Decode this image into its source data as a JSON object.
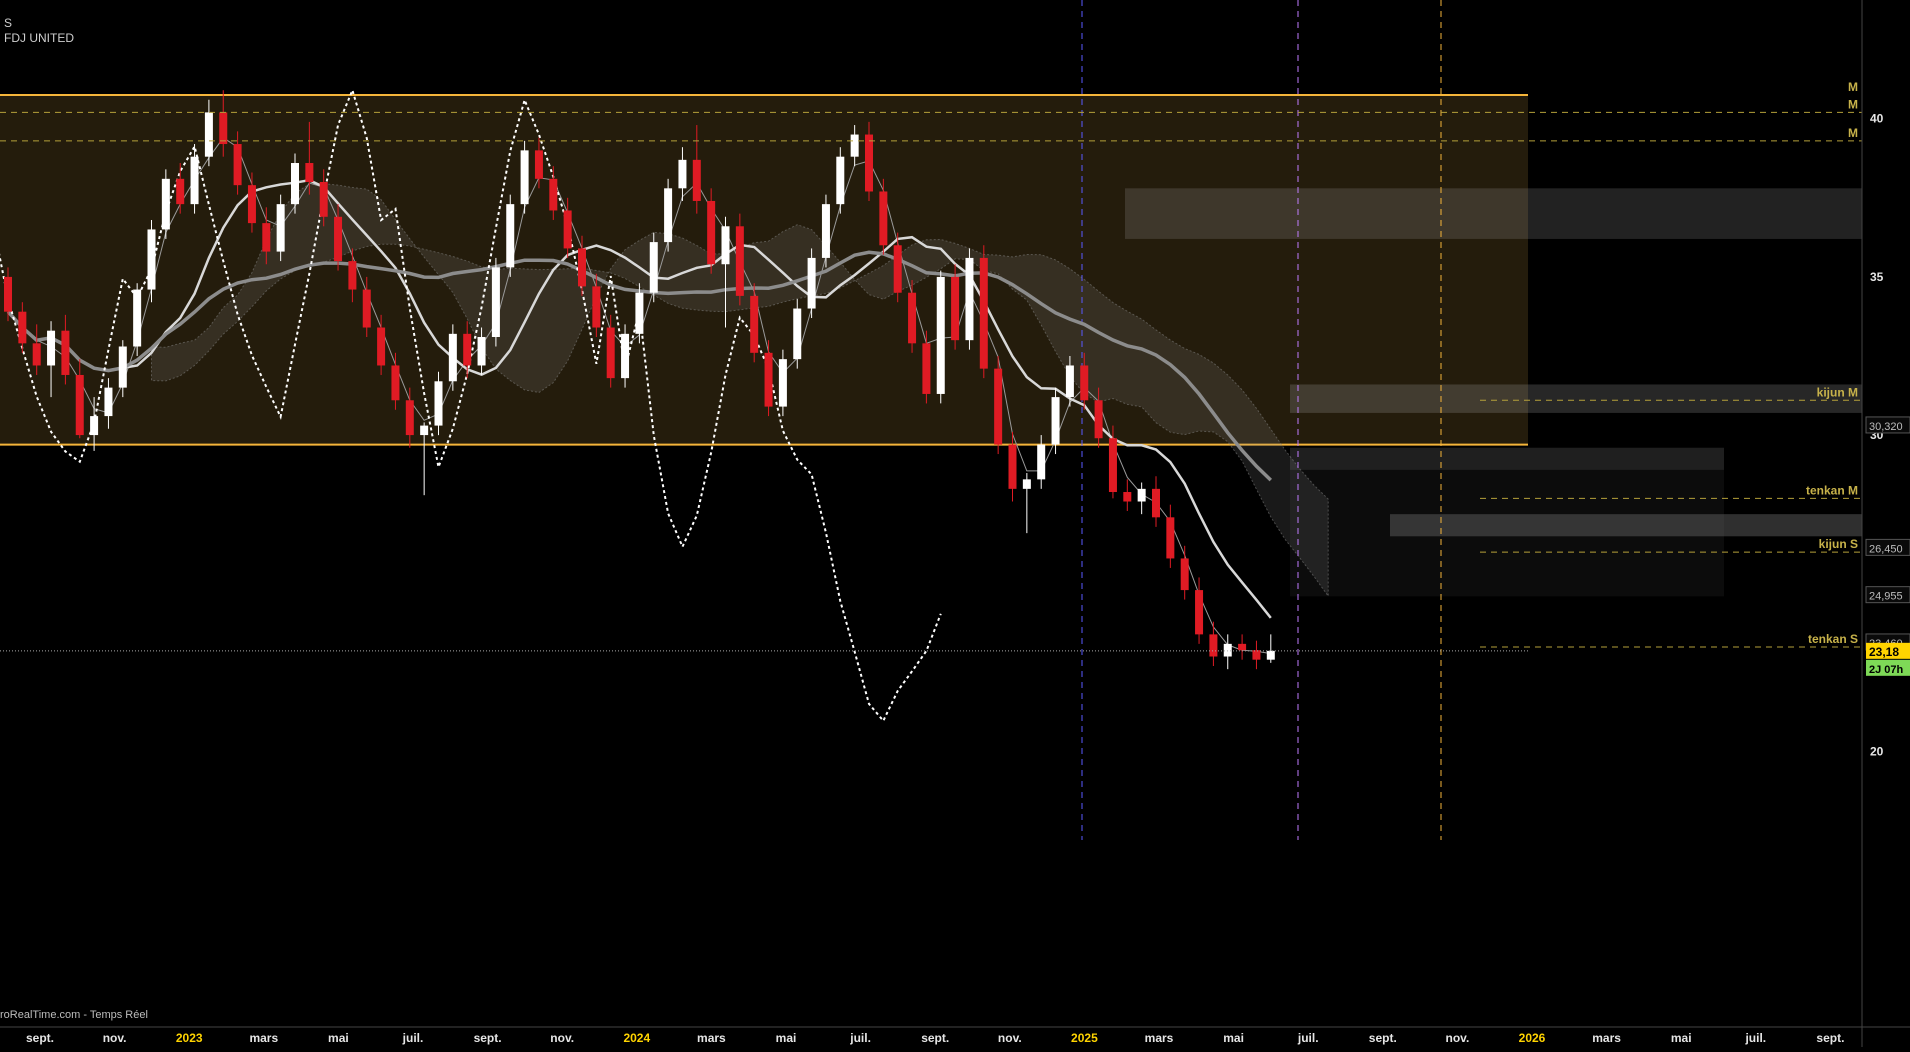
{
  "header": {
    "symbol": "S",
    "name": "FDJ UNITED"
  },
  "footer": {
    "source": "roRealTime.com - Temps Réel"
  },
  "colors": {
    "background": "#000000",
    "up_candle": "#ffffff",
    "down_candle": "#e01b24",
    "band": "#f5b53a",
    "accent_label": "#ffd400",
    "timer": "#7ed957"
  },
  "chart_data": {
    "type": "candlestick",
    "title": "",
    "ylim": [
      17.2,
      43.5
    ],
    "y_ticks": [
      {
        "value": 40,
        "label": "40"
      },
      {
        "value": 35,
        "label": "35"
      },
      {
        "value": 30,
        "label": "30"
      },
      {
        "value": 20,
        "label": "20"
      }
    ],
    "x_ticks": [
      {
        "label": "sept.",
        "major": false
      },
      {
        "label": "nov.",
        "major": false
      },
      {
        "label": "2023",
        "major": true
      },
      {
        "label": "mars",
        "major": false
      },
      {
        "label": "mai",
        "major": false
      },
      {
        "label": "juil.",
        "major": false
      },
      {
        "label": "sept.",
        "major": false
      },
      {
        "label": "nov.",
        "major": false
      },
      {
        "label": "2024",
        "major": true
      },
      {
        "label": "mars",
        "major": false
      },
      {
        "label": "mai",
        "major": false
      },
      {
        "label": "juil.",
        "major": false
      },
      {
        "label": "sept.",
        "major": false
      },
      {
        "label": "nov.",
        "major": false
      },
      {
        "label": "2025",
        "major": true
      },
      {
        "label": "mars",
        "major": false
      },
      {
        "label": "mai",
        "major": false
      },
      {
        "label": "juil.",
        "major": false
      },
      {
        "label": "sept.",
        "major": false
      },
      {
        "label": "nov.",
        "major": false
      },
      {
        "label": "2026",
        "major": true
      },
      {
        "label": "mars",
        "major": false
      },
      {
        "label": "mai",
        "major": false
      },
      {
        "label": "juil.",
        "major": false
      },
      {
        "label": "sept.",
        "major": false
      }
    ],
    "price_tags": [
      {
        "label": "30,320",
        "value": 30.32,
        "style": "box"
      },
      {
        "label": "26,450",
        "value": 26.45,
        "style": "box"
      },
      {
        "label": "24,955",
        "value": 24.955,
        "style": "box"
      },
      {
        "label": "23,460",
        "value": 23.46,
        "style": "box"
      },
      {
        "label": "23,18",
        "value": 23.18,
        "style": "current"
      }
    ],
    "timer": "2J 07h",
    "horizontal_levels": [
      {
        "label": "M",
        "value": 40.75,
        "style": "band-edge"
      },
      {
        "label": "M",
        "value": 40.2,
        "style": "dash"
      },
      {
        "label": "M",
        "value": 39.3,
        "style": "dash"
      },
      {
        "label": "kijun M",
        "value": 31.1,
        "style": "dash"
      },
      {
        "label": "tenkan M",
        "value": 28.0,
        "style": "dash"
      },
      {
        "label": "kijun S",
        "value": 26.3,
        "style": "dash"
      },
      {
        "label": "tenkan S",
        "value": 23.3,
        "style": "dash"
      }
    ],
    "band": {
      "top": 40.75,
      "bottom": 29.7
    },
    "candles": [
      {
        "o": 35.0,
        "h": 35.3,
        "l": 33.6,
        "c": 33.9
      },
      {
        "o": 33.9,
        "h": 34.2,
        "l": 32.6,
        "c": 32.9
      },
      {
        "o": 32.9,
        "h": 33.5,
        "l": 31.9,
        "c": 32.2
      },
      {
        "o": 32.2,
        "h": 33.6,
        "l": 31.2,
        "c": 33.3
      },
      {
        "o": 33.3,
        "h": 33.8,
        "l": 31.6,
        "c": 31.9
      },
      {
        "o": 31.9,
        "h": 32.4,
        "l": 29.9,
        "c": 30.0
      },
      {
        "o": 30.0,
        "h": 31.2,
        "l": 29.5,
        "c": 30.6
      },
      {
        "o": 30.6,
        "h": 31.8,
        "l": 30.2,
        "c": 31.5
      },
      {
        "o": 31.5,
        "h": 33.0,
        "l": 31.2,
        "c": 32.8
      },
      {
        "o": 32.8,
        "h": 34.8,
        "l": 32.5,
        "c": 34.6
      },
      {
        "o": 34.6,
        "h": 36.8,
        "l": 34.2,
        "c": 36.5
      },
      {
        "o": 36.5,
        "h": 38.4,
        "l": 36.2,
        "c": 38.1
      },
      {
        "o": 38.1,
        "h": 38.6,
        "l": 37.0,
        "c": 37.3
      },
      {
        "o": 37.3,
        "h": 39.2,
        "l": 37.0,
        "c": 38.8
      },
      {
        "o": 38.8,
        "h": 40.6,
        "l": 38.5,
        "c": 40.2
      },
      {
        "o": 40.2,
        "h": 40.9,
        "l": 38.8,
        "c": 39.2
      },
      {
        "o": 39.2,
        "h": 39.6,
        "l": 37.6,
        "c": 37.9
      },
      {
        "o": 37.9,
        "h": 38.3,
        "l": 36.4,
        "c": 36.7
      },
      {
        "o": 36.7,
        "h": 37.2,
        "l": 35.4,
        "c": 35.8
      },
      {
        "o": 35.8,
        "h": 37.6,
        "l": 35.5,
        "c": 37.3
      },
      {
        "o": 37.3,
        "h": 38.9,
        "l": 37.0,
        "c": 38.6
      },
      {
        "o": 38.6,
        "h": 39.9,
        "l": 37.6,
        "c": 38.0
      },
      {
        "o": 38.0,
        "h": 38.4,
        "l": 36.6,
        "c": 36.9
      },
      {
        "o": 36.9,
        "h": 37.3,
        "l": 35.2,
        "c": 35.5
      },
      {
        "o": 35.5,
        "h": 35.9,
        "l": 34.2,
        "c": 34.6
      },
      {
        "o": 34.6,
        "h": 35.0,
        "l": 33.1,
        "c": 33.4
      },
      {
        "o": 33.4,
        "h": 33.8,
        "l": 31.9,
        "c": 32.2
      },
      {
        "o": 32.2,
        "h": 32.6,
        "l": 30.8,
        "c": 31.1
      },
      {
        "o": 31.1,
        "h": 31.5,
        "l": 29.6,
        "c": 30.0
      },
      {
        "o": 30.0,
        "h": 30.4,
        "l": 28.1,
        "c": 30.3
      },
      {
        "o": 30.3,
        "h": 32.0,
        "l": 30.0,
        "c": 31.7
      },
      {
        "o": 31.7,
        "h": 33.5,
        "l": 31.4,
        "c": 33.2
      },
      {
        "o": 33.2,
        "h": 33.6,
        "l": 31.8,
        "c": 32.2
      },
      {
        "o": 32.2,
        "h": 33.4,
        "l": 31.9,
        "c": 33.1
      },
      {
        "o": 33.1,
        "h": 35.6,
        "l": 32.8,
        "c": 35.3
      },
      {
        "o": 35.3,
        "h": 37.6,
        "l": 35.0,
        "c": 37.3
      },
      {
        "o": 37.3,
        "h": 39.3,
        "l": 37.0,
        "c": 39.0
      },
      {
        "o": 39.0,
        "h": 39.4,
        "l": 37.8,
        "c": 38.1
      },
      {
        "o": 38.1,
        "h": 38.5,
        "l": 36.8,
        "c": 37.1
      },
      {
        "o": 37.1,
        "h": 37.5,
        "l": 35.6,
        "c": 35.9
      },
      {
        "o": 35.9,
        "h": 36.3,
        "l": 34.4,
        "c": 34.7
      },
      {
        "o": 34.7,
        "h": 35.1,
        "l": 33.1,
        "c": 33.4
      },
      {
        "o": 33.4,
        "h": 33.8,
        "l": 31.5,
        "c": 31.8
      },
      {
        "o": 31.8,
        "h": 33.5,
        "l": 31.5,
        "c": 33.2
      },
      {
        "o": 33.2,
        "h": 34.8,
        "l": 32.9,
        "c": 34.5
      },
      {
        "o": 34.5,
        "h": 36.4,
        "l": 34.2,
        "c": 36.1
      },
      {
        "o": 36.1,
        "h": 38.1,
        "l": 35.8,
        "c": 37.8
      },
      {
        "o": 37.8,
        "h": 39.1,
        "l": 37.4,
        "c": 38.7
      },
      {
        "o": 38.7,
        "h": 39.8,
        "l": 37.0,
        "c": 37.4
      },
      {
        "o": 37.4,
        "h": 37.8,
        "l": 35.1,
        "c": 35.4
      },
      {
        "o": 35.4,
        "h": 36.9,
        "l": 33.4,
        "c": 36.6
      },
      {
        "o": 36.6,
        "h": 37.0,
        "l": 34.1,
        "c": 34.4
      },
      {
        "o": 34.4,
        "h": 34.8,
        "l": 32.3,
        "c": 32.6
      },
      {
        "o": 32.6,
        "h": 33.0,
        "l": 30.6,
        "c": 30.9
      },
      {
        "o": 30.9,
        "h": 32.7,
        "l": 30.6,
        "c": 32.4
      },
      {
        "o": 32.4,
        "h": 34.3,
        "l": 32.1,
        "c": 34.0
      },
      {
        "o": 34.0,
        "h": 35.9,
        "l": 33.7,
        "c": 35.6
      },
      {
        "o": 35.6,
        "h": 37.6,
        "l": 35.3,
        "c": 37.3
      },
      {
        "o": 37.3,
        "h": 39.1,
        "l": 37.0,
        "c": 38.8
      },
      {
        "o": 38.8,
        "h": 39.8,
        "l": 38.5,
        "c": 39.5
      },
      {
        "o": 39.5,
        "h": 39.9,
        "l": 37.4,
        "c": 37.7
      },
      {
        "o": 37.7,
        "h": 38.1,
        "l": 35.7,
        "c": 36.0
      },
      {
        "o": 36.0,
        "h": 36.4,
        "l": 34.2,
        "c": 34.5
      },
      {
        "o": 34.5,
        "h": 34.9,
        "l": 32.6,
        "c": 32.9
      },
      {
        "o": 32.9,
        "h": 33.3,
        "l": 31.0,
        "c": 31.3
      },
      {
        "o": 31.3,
        "h": 35.2,
        "l": 31.0,
        "c": 35.0
      },
      {
        "o": 35.0,
        "h": 35.4,
        "l": 32.7,
        "c": 33.0
      },
      {
        "o": 33.0,
        "h": 35.9,
        "l": 32.7,
        "c": 35.6
      },
      {
        "o": 35.6,
        "h": 36.0,
        "l": 31.8,
        "c": 32.1
      },
      {
        "o": 32.1,
        "h": 32.5,
        "l": 29.4,
        "c": 29.7
      },
      {
        "o": 29.7,
        "h": 30.1,
        "l": 27.9,
        "c": 28.3
      },
      {
        "o": 28.3,
        "h": 28.8,
        "l": 26.9,
        "c": 28.6
      },
      {
        "o": 28.6,
        "h": 30.0,
        "l": 28.3,
        "c": 29.7
      },
      {
        "o": 29.7,
        "h": 31.5,
        "l": 29.4,
        "c": 31.2
      },
      {
        "o": 31.2,
        "h": 32.5,
        "l": 30.9,
        "c": 32.2
      },
      {
        "o": 32.2,
        "h": 32.6,
        "l": 30.8,
        "c": 31.1
      },
      {
        "o": 31.1,
        "h": 31.5,
        "l": 29.6,
        "c": 29.9
      },
      {
        "o": 29.9,
        "h": 30.3,
        "l": 28.0,
        "c": 28.2
      },
      {
        "o": 28.2,
        "h": 28.6,
        "l": 27.6,
        "c": 27.9
      },
      {
        "o": 27.9,
        "h": 28.5,
        "l": 27.5,
        "c": 28.3
      },
      {
        "o": 28.3,
        "h": 28.7,
        "l": 27.1,
        "c": 27.4
      },
      {
        "o": 27.4,
        "h": 27.8,
        "l": 25.8,
        "c": 26.1
      },
      {
        "o": 26.1,
        "h": 26.5,
        "l": 24.8,
        "c": 25.1
      },
      {
        "o": 25.1,
        "h": 25.5,
        "l": 23.4,
        "c": 23.7
      },
      {
        "o": 23.7,
        "h": 24.1,
        "l": 22.7,
        "c": 23.0
      },
      {
        "o": 23.0,
        "h": 23.7,
        "l": 22.6,
        "c": 23.4
      },
      {
        "o": 23.4,
        "h": 23.7,
        "l": 22.9,
        "c": 23.2
      },
      {
        "o": 23.2,
        "h": 23.5,
        "l": 22.6,
        "c": 22.9
      },
      {
        "o": 22.9,
        "h": 23.7,
        "l": 22.8,
        "c": 23.18
      }
    ]
  }
}
